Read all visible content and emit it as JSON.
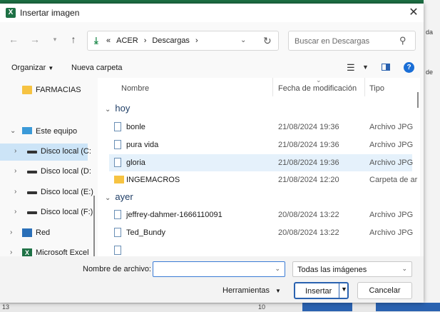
{
  "window": {
    "title": "Insertar imagen",
    "app_icon": "excel-icon",
    "close_label": "✕"
  },
  "address": {
    "prefix": "«",
    "crumbs": [
      "ACER",
      "Descargas"
    ]
  },
  "search": {
    "placeholder": "Buscar en Descargas"
  },
  "toolbar": {
    "organize": "Organizar",
    "new_folder": "Nueva carpeta",
    "help": "?"
  },
  "nav": {
    "items": [
      {
        "label": "FARMACIAS",
        "icon": "folder-icon"
      },
      {
        "label": "Este equipo",
        "icon": "computer-icon"
      },
      {
        "label": "Disco local (C:",
        "icon": "drive-icon"
      },
      {
        "label": "Disco local (D:",
        "icon": "drive-icon"
      },
      {
        "label": "Disco local (E:)",
        "icon": "drive-icon"
      },
      {
        "label": "Disco local (F:)",
        "icon": "drive-icon"
      },
      {
        "label": "Red",
        "icon": "network-icon"
      },
      {
        "label": "Microsoft Excel",
        "icon": "excel-icon"
      }
    ]
  },
  "columns": {
    "name": "Nombre",
    "date": "Fecha de modificación",
    "type": "Tipo"
  },
  "groups": [
    {
      "label": "hoy",
      "files": [
        {
          "name": "bonle",
          "date": "21/08/2024 19:36",
          "type": "Archivo JPG"
        },
        {
          "name": "pura vida",
          "date": "21/08/2024 19:36",
          "type": "Archivo JPG"
        },
        {
          "name": "gloria",
          "date": "21/08/2024 19:36",
          "type": "Archivo JPG"
        },
        {
          "name": "INGEMACROS",
          "date": "21/08/2024 12:20",
          "type": "Carpeta de ar"
        }
      ]
    },
    {
      "label": "ayer",
      "files": [
        {
          "name": "jeffrey-dahmer-1666110091",
          "date": "20/08/2024 13:22",
          "type": "Archivo JPG"
        },
        {
          "name": "Ted_Bundy",
          "date": "20/08/2024 13:22",
          "type": "Archivo JPG"
        }
      ]
    }
  ],
  "footer": {
    "filename_label": "Nombre de archivo:",
    "filename_value": "",
    "filter_value": "Todas las imágenes",
    "tools_label": "Herramientas",
    "insert_label": "Insertar",
    "cancel_label": "Cancelar"
  },
  "background": {
    "right_text": [
      "da",
      "de"
    ],
    "bottom_left": "13",
    "bottom_mid": "10"
  }
}
